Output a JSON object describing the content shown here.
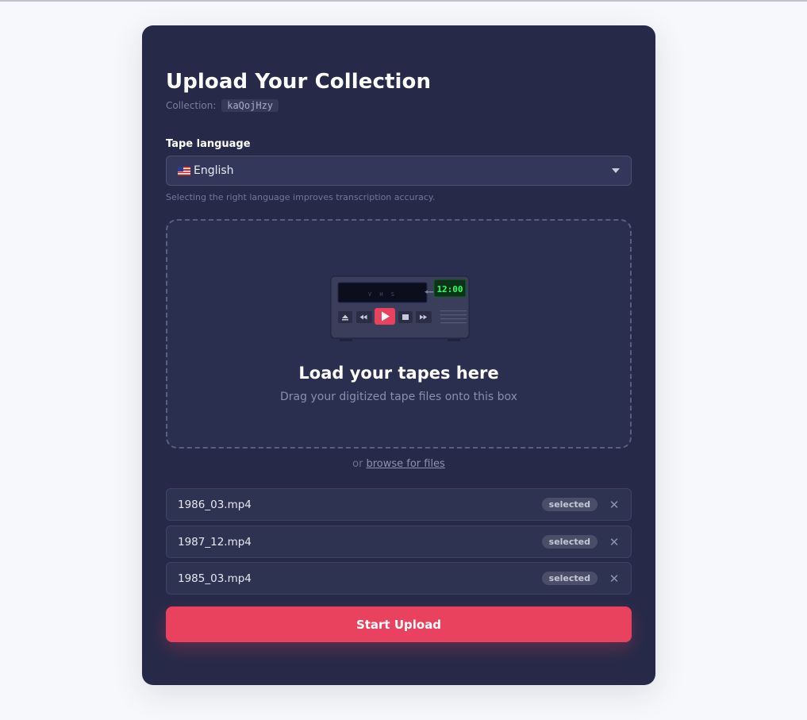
{
  "page": {
    "title": "Upload Your Collection",
    "collection_label": "Collection:",
    "collection_code": "kaQojHzy"
  },
  "language": {
    "label": "Tape language",
    "selected": "English",
    "flag_icon": "us-flag-icon",
    "hint": "Selecting the right language improves transcription accuracy."
  },
  "dropzone": {
    "title": "Load your tapes here",
    "subtitle": "Drag your digitized tape files onto this box",
    "vcr": {
      "brand": "V H S",
      "clock": "12:00"
    }
  },
  "browse": {
    "prefix": "or",
    "link": "browse for files"
  },
  "files": [
    {
      "name": "1986_03.mp4",
      "status": "selected"
    },
    {
      "name": "1987_12.mp4",
      "status": "selected"
    },
    {
      "name": "1985_03.mp4",
      "status": "selected"
    }
  ],
  "actions": {
    "upload_label": "Start Upload"
  },
  "colors": {
    "card": "#262a48",
    "accent": "#e8425f",
    "clock": "#33ff66"
  }
}
